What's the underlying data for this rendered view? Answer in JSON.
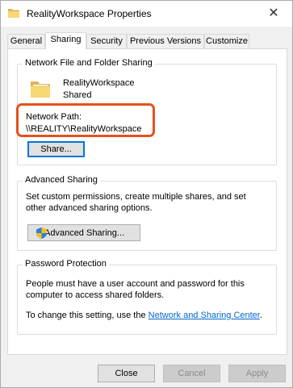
{
  "window": {
    "title": "RealityWorkspace Properties",
    "close_glyph": "✕"
  },
  "tabs": [
    {
      "label": "General",
      "active": false
    },
    {
      "label": "Sharing",
      "active": true
    },
    {
      "label": "Security",
      "active": false
    },
    {
      "label": "Previous Versions",
      "active": false
    },
    {
      "label": "Customize",
      "active": false
    }
  ],
  "network_sharing": {
    "group_label": "Network File and Folder Sharing",
    "folder_name": "RealityWorkspace",
    "folder_status": "Shared",
    "network_path_label": "Network Path:",
    "network_path": "\\\\REALITY\\RealityWorkspace",
    "share_button": "Share..."
  },
  "advanced_sharing": {
    "group_label": "Advanced Sharing",
    "description": "Set custom permissions, create multiple shares, and set other advanced sharing options.",
    "button_label": "Advanced Sharing..."
  },
  "password_protection": {
    "group_label": "Password Protection",
    "description": "People must have a user account and password for this computer to access shared folders.",
    "change_prefix": "To change this setting, use the",
    "link_text": "Network and Sharing Center",
    "change_suffix": "."
  },
  "footer": {
    "close": "Close",
    "cancel": "Cancel",
    "apply": "Apply"
  },
  "colors": {
    "highlight": "#e8501c",
    "link": "#0066cc",
    "focus": "#0078d7"
  },
  "icons": {
    "title": "folder-icon",
    "folder": "folder-icon",
    "advanced_button": "uac-shield-icon"
  }
}
